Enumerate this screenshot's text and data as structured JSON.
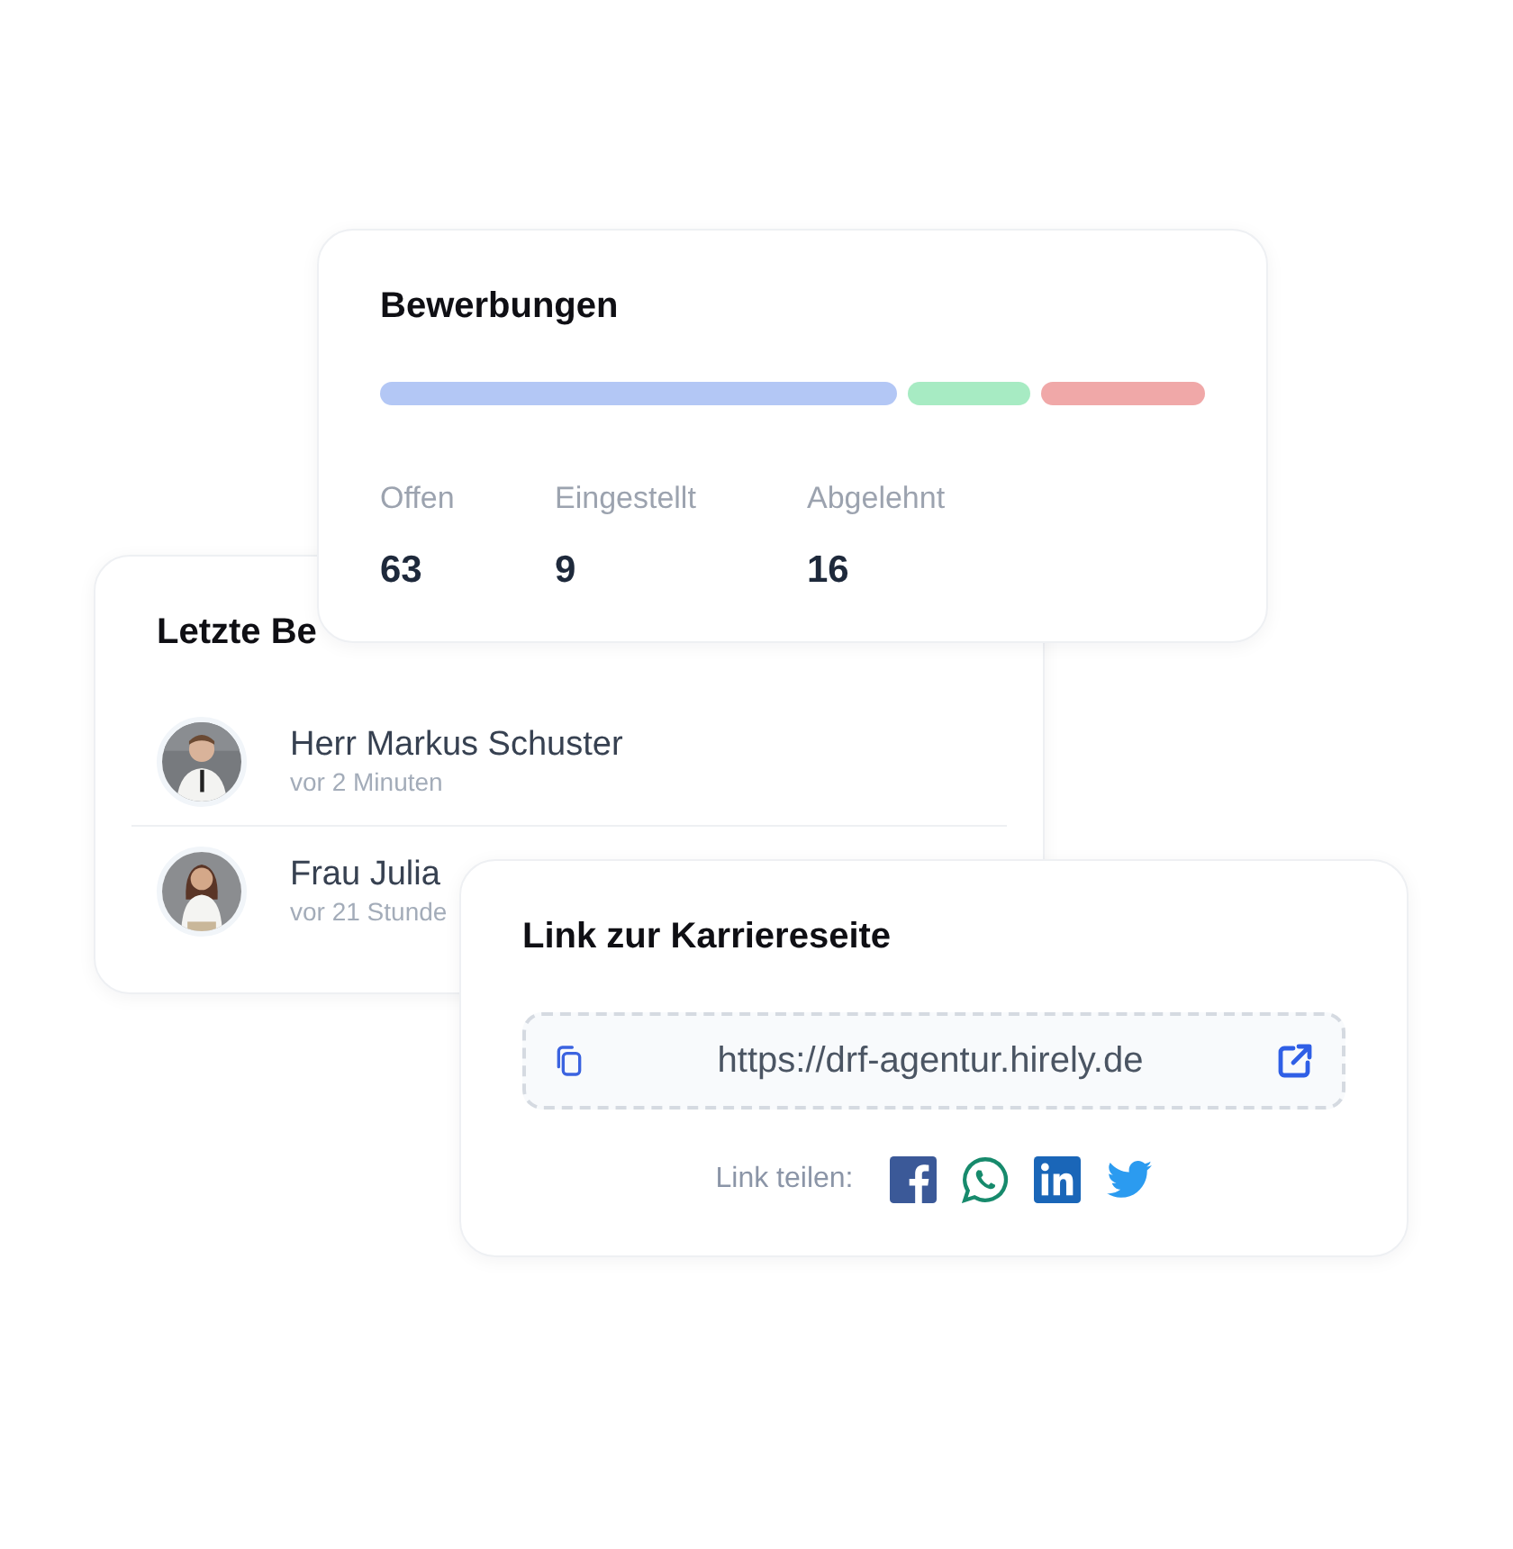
{
  "applications_card": {
    "title": "Bewerbungen",
    "segments": [
      {
        "color": "#b3c7f5"
      },
      {
        "color": "#a7ebc3"
      },
      {
        "color": "#f0a8a8"
      }
    ],
    "stats": [
      {
        "label": "Offen",
        "value": "63"
      },
      {
        "label": "Eingestellt",
        "value": "9"
      },
      {
        "label": "Abgelehnt",
        "value": "16"
      }
    ]
  },
  "recent_card": {
    "title": "Letzte Be",
    "applicants": [
      {
        "name": "Herr Markus Schuster",
        "time": "vor 2 Minuten"
      },
      {
        "name": "Frau Julia",
        "time": "vor 21 Stunde"
      }
    ]
  },
  "career_link_card": {
    "title": "Link zur Karriereseite",
    "url": "https://drf-agentur.hirely.de",
    "share_label": "Link teilen:",
    "share_icons": [
      {
        "kind": "facebook"
      },
      {
        "kind": "whatsapp"
      },
      {
        "kind": "linkedin"
      },
      {
        "kind": "twitter"
      }
    ]
  }
}
